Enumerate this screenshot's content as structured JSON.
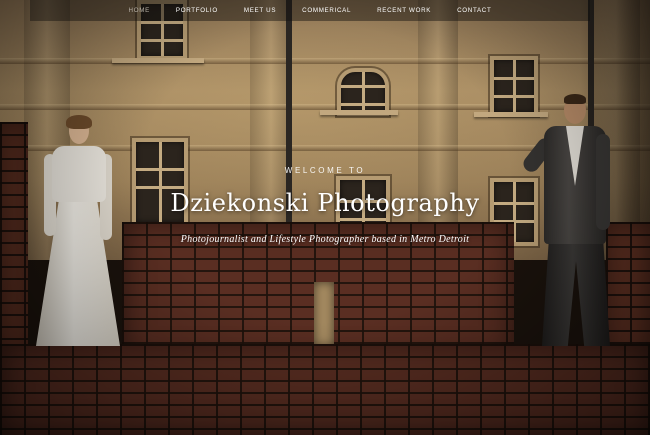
{
  "nav": {
    "items": [
      {
        "label": "HOME",
        "active": true
      },
      {
        "label": "PORTFOLIO",
        "active": false
      },
      {
        "label": "MEET US",
        "active": false
      },
      {
        "label": "COMMERICAL",
        "active": false
      },
      {
        "label": "RECENT WORK",
        "active": false
      },
      {
        "label": "CONTACT",
        "active": false
      }
    ]
  },
  "hero": {
    "kicker": "WELCOME TO",
    "title": "Dziekonski Photography",
    "tagline": "Photojournalist and Lifestyle Photographer based in Metro Detroit"
  },
  "colors": {
    "text": "#ffffff",
    "active_nav": "#b8b2a8",
    "brick": "#5a2e22",
    "facade": "#a88c63"
  }
}
